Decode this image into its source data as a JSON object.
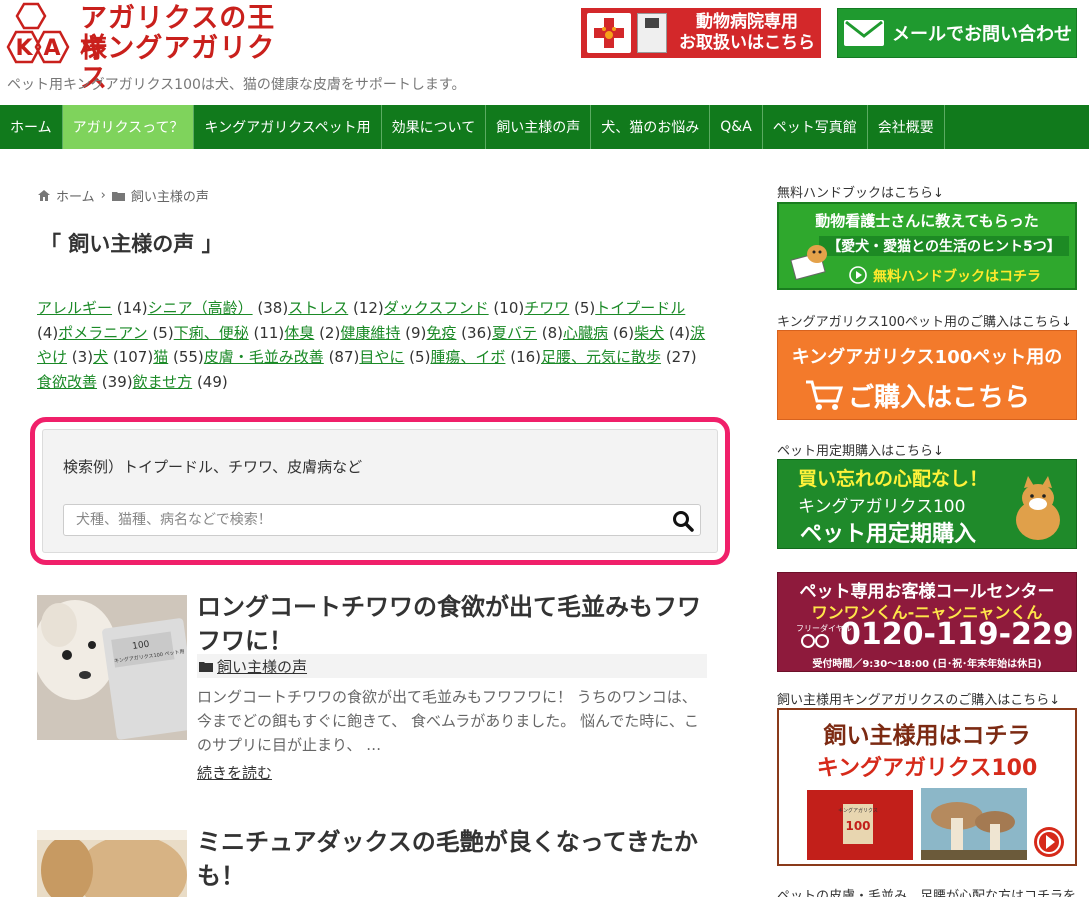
{
  "header": {
    "logo_letters": [
      "K",
      "A"
    ],
    "logo_line1": "アガリクスの王様",
    "logo_line2": "キングアガリクス",
    "tagline": "ペット用キングアガリクス100は犬、猫の健康な皮膚をサポートします。",
    "vet_button_line1": "動物病院専用",
    "vet_button_line2": "お取扱いはこちら",
    "mail_button": "メールでお問い合わせ"
  },
  "nav": {
    "items": [
      {
        "label": "ホーム"
      },
      {
        "label": "アガリクスって？"
      },
      {
        "label": "キングアガリクスペット用"
      },
      {
        "label": "効果について"
      },
      {
        "label": "飼い主様の声"
      },
      {
        "label": "犬、猫のお悩み"
      },
      {
        "label": "Q&A"
      },
      {
        "label": "ペット写真館"
      },
      {
        "label": "会社概要"
      }
    ],
    "active_index": 1
  },
  "breadcrumb": {
    "home": "ホーム",
    "sep": "›",
    "current": "飼い主様の声"
  },
  "page_title": "「 飼い主様の声 」",
  "tags": [
    {
      "label": "アレルギー",
      "count": "(14)"
    },
    {
      "label": "シニア（高齢）",
      "count": "(38)"
    },
    {
      "label": "ストレス",
      "count": "(12)"
    },
    {
      "label": "ダックスフンド",
      "count": "(10)"
    },
    {
      "label": "チワワ",
      "count": "(5)"
    },
    {
      "label": "トイプードル",
      "count": "(4)"
    },
    {
      "label": "ポメラニアン",
      "count": "(5)"
    },
    {
      "label": "下痢、便秘",
      "count": "(11)"
    },
    {
      "label": "体臭",
      "count": "(2)"
    },
    {
      "label": "健康維持",
      "count": "(9)"
    },
    {
      "label": "免疫",
      "count": "(36)"
    },
    {
      "label": "夏バテ",
      "count": "(8)"
    },
    {
      "label": "心臓病",
      "count": "(6)"
    },
    {
      "label": "柴犬",
      "count": "(4)"
    },
    {
      "label": "涙やけ",
      "count": "(3)"
    },
    {
      "label": "犬",
      "count": "(107)"
    },
    {
      "label": "猫",
      "count": "(55)"
    },
    {
      "label": "皮膚・毛並み改善",
      "count": "(87)"
    },
    {
      "label": "目やに",
      "count": "(5)"
    },
    {
      "label": "腫瘍、イボ",
      "count": "(16)"
    },
    {
      "label": "足腰、元気に散歩",
      "count": "(27)"
    },
    {
      "label": "食欲改善",
      "count": "(39)"
    },
    {
      "label": "飲ませ方",
      "count": "(49)"
    }
  ],
  "search": {
    "example": "検索例）トイプードル、チワワ、皮膚病など",
    "placeholder": "犬種、猫種、病名などで検索！"
  },
  "posts": [
    {
      "title": "ロングコートチワワの食欲が出て毛並みもフワフワに！",
      "category": "飼い主様の声",
      "excerpt": "ロングコートチワワの食欲が出て毛並みもフワフワに！ うちのワンコは、今までどの餌もすぐに飽きて、 食べムラがありました。 悩んでた時に、このサプリに目が止まり、 …",
      "more": "続きを読む",
      "thumb_pkg_number": "100",
      "thumb_pkg_text": "キングアガリクス100 ペット用"
    },
    {
      "title": "ミニチュアダックスの毛艶が良くなってきたかも！"
    }
  ],
  "sidebar": {
    "captions": [
      "無料ハンドブックはこちら↓",
      "キングアガリクス100ペット用のご購入はこちら↓",
      "ペット用定期購入はこちら↓",
      "飼い主様用キングアガリクスのご購入はこちら↓",
      "ペットの皮膚・毛並み、足腰が心配な方はコチラを"
    ],
    "banner1": {
      "line1": "動物看護士さんに教えてもらった",
      "line2": "【愛犬・愛猫との生活のヒント5つ】",
      "line3": "無料ハンドブックはコチラ"
    },
    "banner2": {
      "line1": "キングアガリクス100ペット用の",
      "line2": "ご購入はこちら"
    },
    "banner3": {
      "line1": "買い忘れの心配なし！",
      "line2": "キングアガリクス100",
      "line3": "ペット用定期購入"
    },
    "banner4": {
      "line1": "ペット専用お客様コールセンター",
      "line2": "ワンワンくん-ニャンニャンくん",
      "free_dial": "フリーダイヤル",
      "phone": "0120-119-229",
      "hours": "受付時間／9:30～18:00 (日･祝･年末年始は休日)"
    },
    "banner5": {
      "line1": "飼い主様用はコチラ",
      "line2": "キングアガリクス100",
      "pkg_number": "100",
      "pkg_text": "キングアガリクス"
    }
  },
  "colors": {
    "nav_bg": "#117a1c",
    "nav_active": "#7fd35c",
    "link": "#1b8a27",
    "search_border": "#f0206a",
    "logo_red": "#c9201c"
  }
}
